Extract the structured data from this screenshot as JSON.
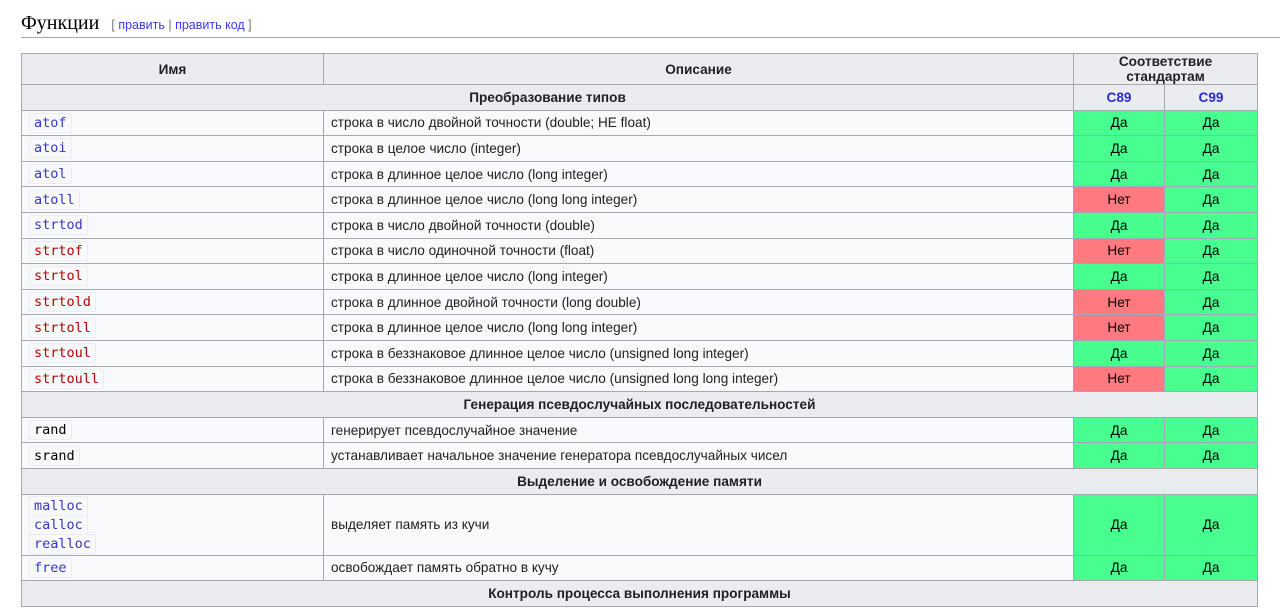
{
  "section": {
    "title": "Функции",
    "edit_open": "[",
    "edit_label": "править",
    "edit_sep": "|",
    "edit_code_label": "править код",
    "edit_close": "]"
  },
  "table": {
    "headers": {
      "name": "Имя",
      "desc": "Описание",
      "std": "Соответствие стандартам"
    },
    "std_cols": [
      "C89",
      "C99"
    ],
    "groups": [
      {
        "title": "Преобразование типов",
        "rows": [
          {
            "names": [
              {
                "t": "atof",
                "c": "blue"
              }
            ],
            "desc": "строка в число двойной точности (double; НЕ float)",
            "c89": "Да",
            "c99": "Да"
          },
          {
            "names": [
              {
                "t": "atoi",
                "c": "blue"
              }
            ],
            "desc": "строка в целое число (integer)",
            "c89": "Да",
            "c99": "Да"
          },
          {
            "names": [
              {
                "t": "atol",
                "c": "blue"
              }
            ],
            "desc": "строка в длинное целое число (long integer)",
            "c89": "Да",
            "c99": "Да"
          },
          {
            "names": [
              {
                "t": "atoll",
                "c": "blue"
              }
            ],
            "desc": "строка в длинное целое число (long long integer)",
            "c89": "Нет",
            "c99": "Да"
          },
          {
            "names": [
              {
                "t": "strtod",
                "c": "blue"
              }
            ],
            "desc": "строка в число двойной точности (double)",
            "c89": "Да",
            "c99": "Да"
          },
          {
            "names": [
              {
                "t": "strtof",
                "c": "red"
              }
            ],
            "desc": "строка в число одиночной точности (float)",
            "c89": "Нет",
            "c99": "Да"
          },
          {
            "names": [
              {
                "t": "strtol",
                "c": "red"
              }
            ],
            "desc": "строка в длинное целое число (long integer)",
            "c89": "Да",
            "c99": "Да"
          },
          {
            "names": [
              {
                "t": "strtold",
                "c": "red"
              }
            ],
            "desc": "строка в длинное двойной точности (long double)",
            "c89": "Нет",
            "c99": "Да"
          },
          {
            "names": [
              {
                "t": "strtoll",
                "c": "red"
              }
            ],
            "desc": "строка в длинное целое число (long long integer)",
            "c89": "Нет",
            "c99": "Да"
          },
          {
            "names": [
              {
                "t": "strtoul",
                "c": "red"
              }
            ],
            "desc": "строка в беззнаковое длинное целое число (unsigned long integer)",
            "c89": "Да",
            "c99": "Да"
          },
          {
            "names": [
              {
                "t": "strtoull",
                "c": "red"
              }
            ],
            "desc": "строка в беззнаковое длинное целое число (unsigned long long integer)",
            "c89": "Нет",
            "c99": "Да"
          }
        ]
      },
      {
        "title": "Генерация псевдослучайных последовательностей",
        "rows": [
          {
            "names": [
              {
                "t": "rand",
                "c": "black"
              }
            ],
            "desc": "генерирует псевдослучайное значение",
            "c89": "Да",
            "c99": "Да"
          },
          {
            "names": [
              {
                "t": "srand",
                "c": "black"
              }
            ],
            "desc": "устанавливает начальное значение генератора псевдослучайных чисел",
            "c89": "Да",
            "c99": "Да"
          }
        ]
      },
      {
        "title": "Выделение и освобождение памяти",
        "rows": [
          {
            "names": [
              {
                "t": "malloc",
                "c": "blue"
              },
              {
                "t": "calloc",
                "c": "blue"
              },
              {
                "t": "realloc",
                "c": "blue"
              }
            ],
            "desc": "выделяет память из кучи",
            "c89": "Да",
            "c99": "Да"
          },
          {
            "names": [
              {
                "t": "free",
                "c": "blue"
              }
            ],
            "desc": "освобождает память обратно в кучу",
            "c89": "Да",
            "c99": "Да"
          }
        ]
      },
      {
        "title": "Контроль процесса выполнения программы",
        "rows": []
      }
    ]
  },
  "colors": {
    "yes": "#47fe8e",
    "no": "#fe7a7e",
    "link": "#3636c8",
    "redlink": "#ba0000"
  }
}
